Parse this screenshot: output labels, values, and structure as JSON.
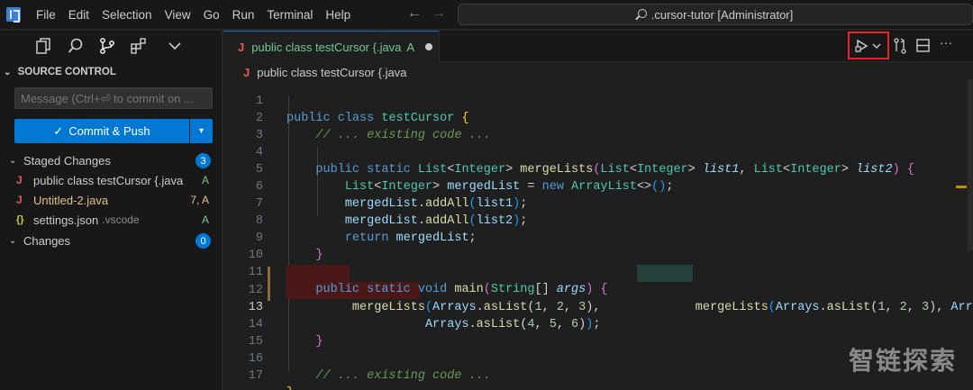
{
  "window": {
    "menu": [
      "File",
      "Edit",
      "Selection",
      "View",
      "Go",
      "Run",
      "Terminal",
      "Help"
    ],
    "search_text": ".cursor-tutor [Administrator]"
  },
  "sidebar": {
    "header": "SOURCE CONTROL",
    "message_placeholder": "Message (Ctrl+⏎ to commit on ...",
    "commit_button": "Commit & Push",
    "staged": {
      "label": "Staged Changes",
      "count": "3",
      "files": [
        {
          "icon": "J",
          "name": "public class testCursor {.java",
          "desc": "",
          "status": "A"
        },
        {
          "icon": "J",
          "name": "Untitled-2.java",
          "desc": "",
          "status": "7, A"
        },
        {
          "icon": "{}",
          "name": "settings.json",
          "desc": ".vscode",
          "status": "A"
        }
      ]
    },
    "changes": {
      "label": "Changes",
      "count": "0"
    }
  },
  "editor": {
    "tab": {
      "icon": "J",
      "name": "public class testCursor {.java",
      "status": "A"
    },
    "breadcrumb": "public class testCursor {.java",
    "line_numbers": [
      "1",
      "2",
      "3",
      "4",
      "5",
      "6",
      "7",
      "8",
      "9",
      "10",
      "11",
      "12",
      "13",
      "14",
      "15",
      "16",
      "17"
    ],
    "watermark": "智链探索"
  },
  "colors": {
    "accent": "#0078d4",
    "highlight_box": "#e5232b",
    "added_status": "#73c991",
    "modified_status": "#e2c08d"
  }
}
